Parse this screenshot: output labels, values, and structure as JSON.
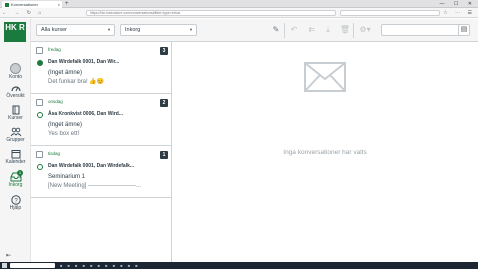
{
  "browser": {
    "tab_title": "Konversationer",
    "tab_close": "×",
    "new_tab": "+",
    "url": "https://hkr.instructure.com/conversations#filter=type=inbox",
    "window_controls": "— ☐ ✕",
    "nav_icons": "← → ↻ ⌂",
    "tool_icons": "☆ ⋯ ☰"
  },
  "global_nav": {
    "logo_text": "HK R",
    "items": [
      {
        "label": "Konto",
        "icon": "account-avatar"
      },
      {
        "label": "Översikt",
        "icon": "dashboard-icon"
      },
      {
        "label": "Kurser",
        "icon": "courses-icon"
      },
      {
        "label": "Grupper",
        "icon": "groups-icon"
      },
      {
        "label": "Kalender",
        "icon": "calendar-icon"
      },
      {
        "label": "Inkorg",
        "icon": "inbox-icon",
        "badge": "1",
        "active": true
      },
      {
        "label": "Hjälp",
        "icon": "help-icon"
      }
    ]
  },
  "toolbar": {
    "course_filter": "Alla kurser",
    "mailbox_filter": "Inkorg",
    "icons": [
      "compose-icon",
      "reply-icon",
      "reply-all-icon",
      "archive-icon",
      "delete-icon",
      "settings-icon"
    ],
    "address_book_icon": "address-book-icon"
  },
  "conversations": [
    {
      "date": "fredag",
      "count": "3",
      "participants": "Dan Wirdefalk 0001, Dan Wir...",
      "subject": "(Inget ämne)",
      "preview": "Det funkar bra! 👍😊",
      "unread": true
    },
    {
      "date": "onsdag",
      "count": "2",
      "participants": "Åsa Kronkvist 0006, Dan Wird...",
      "subject": "(Inget ämne)",
      "preview": "Yes box ett!",
      "unread": false
    },
    {
      "date": "tisdag",
      "count": "1",
      "participants": "Dan Wirdefalk 0001, Dan Wirdefalk...",
      "subject": "Seminarium 1",
      "preview": "[New Meeting] ------------------------...",
      "unread": false
    }
  ],
  "empty_state": {
    "message": "Inga konversationer har valts",
    "icon": "envelope-icon"
  },
  "colors": {
    "brand": "#1b7a3e",
    "text": "#2d3b45",
    "muted": "#9aa3a9"
  }
}
